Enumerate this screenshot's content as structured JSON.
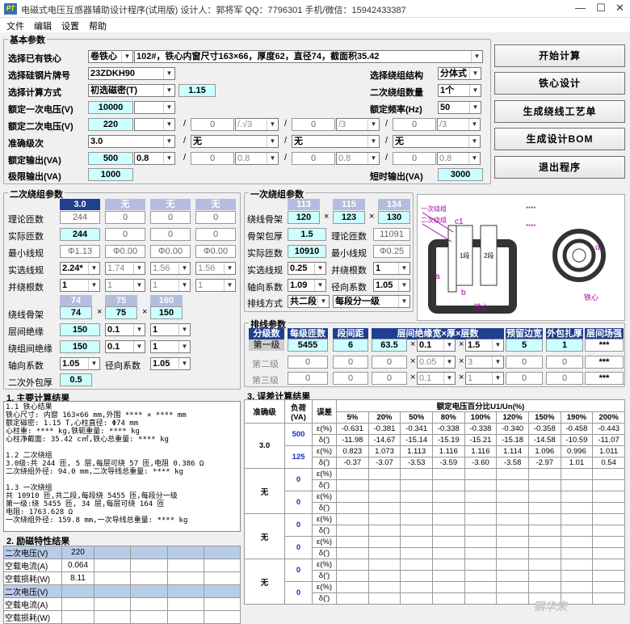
{
  "app": {
    "title": "电磁式电压互感器辅助设计程序(试用版)  设计人：郭将军  QQ：7796301  手机/微信：15942433387",
    "logo": "PT",
    "menu": [
      "文件",
      "编辑",
      "设置",
      "帮助"
    ]
  },
  "basic": {
    "group_title": "基本参数",
    "core_label": "选择已有铁心",
    "core_type": "卷铁心",
    "core_desc": "102#，铁心内窗尺寸163×66，厚度62，直径74，截面积35.42",
    "steel_label": "选择硅钢片牌号",
    "steel": "23ZDKH90",
    "calc_label": "选择计算方式",
    "calc": "初选磁密(T)",
    "calc_val": "1.15",
    "v1_label": "额定一次电压(V)",
    "v1": "10000",
    "v2_label": "额定二次电压(V)",
    "v2": "220",
    "v2_b": "0",
    "v2_b_sel": "/.√3",
    "v2_c": "0",
    "v2_c_sel": "/3",
    "v2_d": "0",
    "v2_d_sel": "/3",
    "acc_label": "准确级次",
    "acc": "3.0",
    "acc_b": "无",
    "acc_c": "无",
    "acc_d": "无",
    "out_label": "额定输出(VA)",
    "out": "500",
    "out_pf": "0.8",
    "out_b": "0",
    "out_b_pf": "0.8",
    "out_c": "0",
    "out_c_pf": "0.8",
    "out_d": "0",
    "out_d_pf": "0.8",
    "limit_label": "极限输出(VA)",
    "limit": "1000",
    "struct_label": "选择绕组结构",
    "struct": "分体式",
    "n2_label": "二次绕组数量",
    "n2": "1个",
    "freq_label": "额定频率(Hz)",
    "freq": "50",
    "short_label": "短时输出(VA)",
    "short": "3000",
    "sep": "/"
  },
  "buttons": [
    "开始计算",
    "铁心设计",
    "生成绕线工艺单",
    "生成设计BOM",
    "退出程序"
  ],
  "sec": {
    "group_title": "二次绕组参数",
    "cols": [
      "3.0",
      "无",
      "无",
      "无"
    ],
    "cols2": [
      "74",
      "75",
      "160"
    ],
    "rows": [
      {
        "label": "理论匝数",
        "v": [
          "244",
          "0",
          "0",
          "0"
        ]
      },
      {
        "label": "实际匝数",
        "v": [
          "244",
          "0",
          "0",
          "0"
        ]
      },
      {
        "label": "最小线规",
        "v": [
          "Φ1.13",
          "Φ0.00",
          "Φ0.00",
          "Φ0.00"
        ]
      },
      {
        "label": "实选线规",
        "v": [
          "2.24*",
          "1.74",
          "1.56",
          "1.56"
        ]
      },
      {
        "label": "并绕根数",
        "v": [
          "1",
          "1",
          "1",
          "1"
        ]
      }
    ],
    "bobbin_label": "绕线骨架",
    "bobbin": [
      "74",
      "75",
      "150"
    ],
    "layer_ins_label": "层间绝缘",
    "layer_ins": [
      "150",
      "0.1",
      "1"
    ],
    "wind_ins_label": "绕组间绝缘",
    "wind_ins": [
      "150",
      "0.1",
      "1"
    ],
    "axial_label": "轴向系数",
    "axial": "1.05",
    "radial_label": "径向系数",
    "radial": "1.05",
    "wrap_label": "二次外包厚",
    "wrap": "0.5",
    "times": "×"
  },
  "pri": {
    "group_title": "一次绕组参数",
    "cols": [
      "113",
      "115",
      "134"
    ],
    "bobbin_label": "绕线骨架",
    "bobbin": [
      "120",
      "123",
      "130"
    ],
    "wall_label": "骨架包厚",
    "wall": "1.5",
    "th_label": "理论匝数",
    "th": "11091",
    "act_label": "实际匝数",
    "act": "10910",
    "min_label": "最小线规",
    "min": "Φ0.25",
    "sel_label": "实选线规",
    "sel": "0.25",
    "par_label": "并绕根数",
    "par": "1",
    "axial_label": "轴向系数",
    "axial": "1.09",
    "radial_label": "径向系数",
    "radial": "1.05",
    "arr_label": "排线方式",
    "arr": "共二段",
    "arr2": "每段分一级"
  },
  "diagram": {
    "l1": "一次绕组",
    "l2": "二次绕组",
    "c1": "c1",
    "a": "a",
    "b": "b",
    "seg1": "1段",
    "seg2": "2段",
    "core": "铁心",
    "stars": "****",
    "d": "d",
    "core2": "铁心"
  },
  "layout": {
    "group_title": "排线参数",
    "headers": [
      "分级数",
      "每级匝数",
      "段间距",
      "层间绝缘宽×厚×层数",
      "预留边宽",
      "外包扎厚",
      "层间场强"
    ],
    "rows": [
      {
        "label": "第一级",
        "v": [
          "5455",
          "6",
          "63.5",
          "0.1",
          "1.5",
          "5",
          "1",
          "***"
        ]
      },
      {
        "label": "第二级",
        "v": [
          "0",
          "0",
          "0",
          "0.05",
          "3",
          "0",
          "0",
          "***"
        ]
      },
      {
        "label": "第三级",
        "v": [
          "0",
          "0",
          "0",
          "0.1",
          "1",
          "0",
          "0",
          "***"
        ]
      }
    ]
  },
  "results": {
    "group_title": "1. 主要计算结果",
    "text": "1.1 铁心结果\n铁心尺寸: 内窗 163×66 mm,外围 **** × **** mm\n额定磁密: 1.15 T,心柱直径: Φ74 mm\n心柱重: **** kg,铁轭重量: **** kg\n心柱净截面: 35.42 c㎡,铁心总重量: **** kg\n\n1.2 二次绕组\n3.0级:共 244 匝, 5 层,每层可绕 57 匝,电阻 0.386 Ω\n二次绕组外径: 94.0 mm,二次导线总重量: **** kg\n\n1.3 一次绕组\n共 10910 匝,共二段,每段绕 5455 匝,每段分一级\n第一级:绕 5455 匝, 34 层,每层可绕 164 匝\n电阻: 1763.628 Ω\n一次绕组外径: 159.8 mm,一次导线总重量: **** kg"
  },
  "excitation": {
    "group_title": "2. 励磁特性结果",
    "rows": [
      {
        "label": "二次电压(V)",
        "v": "220",
        "hdr": true
      },
      {
        "label": "空载电流(A)",
        "v": "0.064",
        "hdr": false
      },
      {
        "label": "空载损耗(W)",
        "v": "8.11",
        "hdr": false
      },
      {
        "label": "二次电压(V)",
        "v": "",
        "hdr": true
      },
      {
        "label": "空载电流(A)",
        "v": "",
        "hdr": false
      },
      {
        "label": "空载损耗(W)",
        "v": "",
        "hdr": false
      }
    ]
  },
  "error": {
    "group_title": "3. 误差计算结果",
    "h_acc": "准确级",
    "h_load": "负荷\n(VA)",
    "h_err": "误差",
    "h_span": "额定电压百分比U1/Un(%)",
    "pcts": [
      "5%",
      "20%",
      "50%",
      "80%",
      "100%",
      "120%",
      "150%",
      "190%",
      "200%"
    ],
    "eps": "ε(%)",
    "delta": "δ(')",
    "blocks": [
      {
        "acc": "3.0",
        "loads": [
          {
            "load": "500",
            "e": [
              "-0.631",
              "-0.381",
              "-0.341",
              "-0.338",
              "-0.338",
              "-0.340",
              "-0.358",
              "-0.458",
              "-0.443"
            ],
            "d": [
              "-11.98",
              "-14.67",
              "-15.14",
              "-15.19",
              "-15.21",
              "-15.18",
              "-14.58",
              "-10.59",
              "-11.07"
            ]
          },
          {
            "load": "125",
            "e": [
              "0.823",
              "1.073",
              "1.113",
              "1.116",
              "1.116",
              "1.114",
              "1.096",
              "0.996",
              "1.011"
            ],
            "d": [
              "-0.37",
              "-3.07",
              "-3.53",
              "-3.59",
              "-3.60",
              "-3.58",
              "-2.97",
              "1.01",
              "0.54"
            ]
          }
        ]
      },
      {
        "acc": "无",
        "loads": [
          {
            "load": "0"
          },
          {
            "load": "0"
          }
        ]
      },
      {
        "acc": "无",
        "loads": [
          {
            "load": "0"
          },
          {
            "load": "0"
          }
        ]
      },
      {
        "acc": "无",
        "loads": [
          {
            "load": "0"
          },
          {
            "load": "0"
          }
        ]
      }
    ]
  },
  "watermark": "钢华来"
}
